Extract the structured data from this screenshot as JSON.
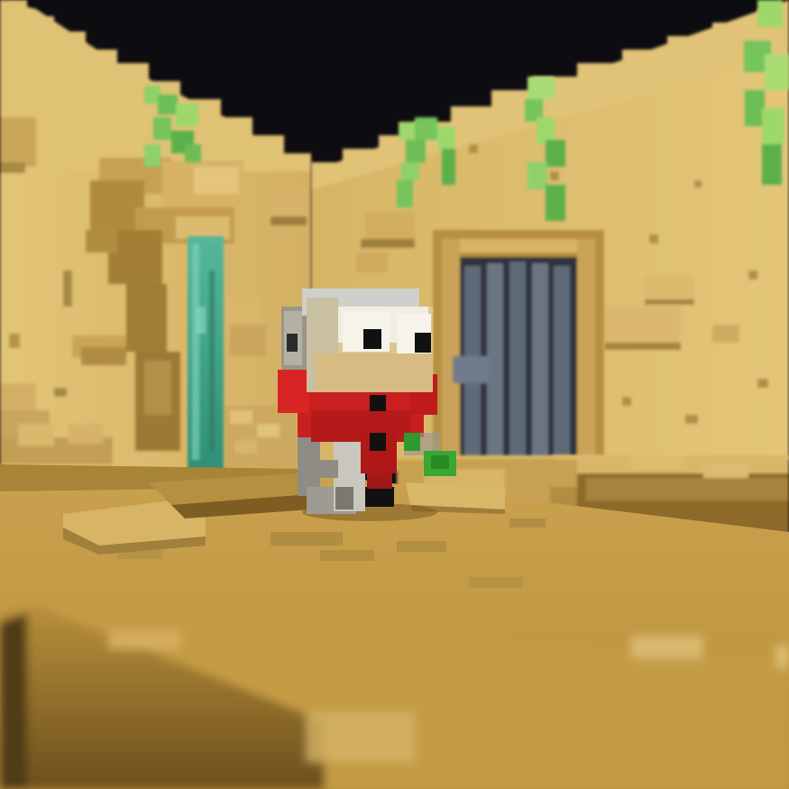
{
  "scene": {
    "type": "voxel-dungeon-room",
    "camera": "low-angle-third-person",
    "depth_of_field": true
  },
  "palette": {
    "sky": "#0d0c10",
    "sand_light": "#e2c172",
    "sand_mid": "#d2ad5c",
    "sand_dark": "#a98838",
    "sand_shadow": "#6e5420",
    "floor": "#c9a350",
    "floor_near": "#b8933f",
    "vine_light": "#9fd86a",
    "vine_dark": "#5bb049",
    "water": "#3fa58c",
    "gate": "#5b6673",
    "gate_dark": "#3b424c",
    "hero_red": "#c81f1f",
    "hero_red_dark": "#8e1414",
    "hero_skin": "#d9c08a",
    "hero_gray": "#b9b9b3",
    "hero_black": "#111111",
    "hero_leaf": "#38a832"
  },
  "entities": {
    "hero": {
      "role": "player-character",
      "facing": "camera"
    },
    "gate": {
      "role": "locked-portcullis",
      "state": "closed"
    },
    "waterfall": {
      "role": "water-stream"
    },
    "vines": {
      "count": 5
    }
  }
}
